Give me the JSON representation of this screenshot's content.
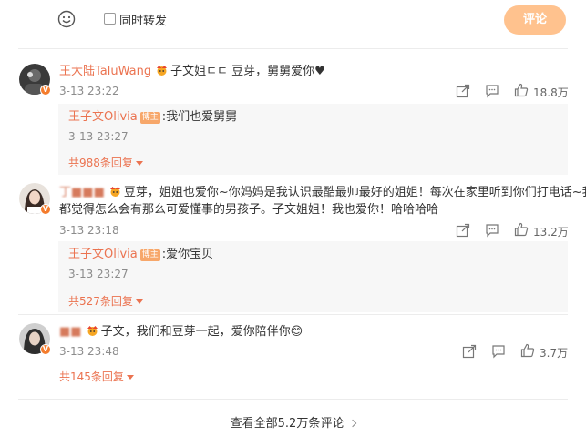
{
  "composer": {
    "repost_label": "同时转发",
    "submit_label": "评论"
  },
  "comments": [
    {
      "user": "王大陆TaluWang",
      "text": "子文姐ㄷㄷ 豆芽，舅舅爱你♥",
      "time": "3-13 23:22",
      "likes": "18.8万",
      "reply": {
        "user": "王子文Olivia",
        "tag": "博主",
        "text": ":我们也爱舅舅",
        "time": "3-13 23:27"
      },
      "more": "共988条回复"
    },
    {
      "user": "丁■■■",
      "text_line1": "豆芽，姐姐也爱你~你妈妈是我认识最酷最帅最好的姐姐！每次在家里听到你们打电话~我",
      "text_line2": "都觉得怎么会有那么可爱懂事的男孩子。子文姐姐！我也爱你！哈哈哈哈",
      "time": "3-13 23:18",
      "likes": "13.2万",
      "reply": {
        "user": "王子文Olivia",
        "tag": "博主",
        "text": ":爱你宝贝",
        "time": "3-13 23:27"
      },
      "more": "共527条回复"
    },
    {
      "user": "■■",
      "text": "子文，我们和豆芽一起，爱你陪伴你😊",
      "time": "3-13 23:48",
      "likes": "3.7万",
      "more": "共145条回复"
    }
  ],
  "footer": {
    "view_all": "查看全部5.2万条评论"
  },
  "colors": {
    "accent": "#eb7350",
    "submit_bg": "#ffc28e",
    "reply_bg": "#f7f7f7",
    "verified": "#f47c2d"
  }
}
